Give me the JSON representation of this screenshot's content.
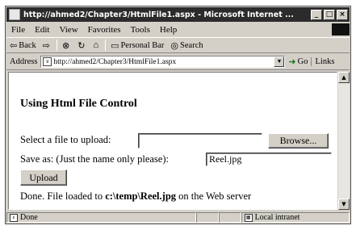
{
  "window": {
    "title": "http://ahmed2/Chapter3/HtmlFile1.aspx - Microsoft Internet ...",
    "controls": [
      "_",
      "□",
      "×"
    ]
  },
  "menu": [
    "File",
    "Edit",
    "View",
    "Favorites",
    "Tools",
    "Help"
  ],
  "toolbar": {
    "back": "Back",
    "personal_bar": "Personal Bar",
    "search": "Search"
  },
  "address": {
    "label": "Address",
    "url": "http://ahmed2/Chapter3/HtmlFile1.aspx",
    "go": "Go",
    "links": "Links"
  },
  "page": {
    "heading": "Using Html File Control",
    "select_label": "Select a file to upload:",
    "browse_button": "Browse...",
    "saveas_label": "Save as: (Just the name only please):",
    "saveas_value": "Reel.jpg",
    "upload_button": "Upload",
    "done_prefix": "Done. File loaded to ",
    "done_path": "c:\\temp\\Reel.jpg",
    "done_suffix": " on the Web server"
  },
  "status": {
    "left": "Done",
    "zone": "Local intranet"
  }
}
